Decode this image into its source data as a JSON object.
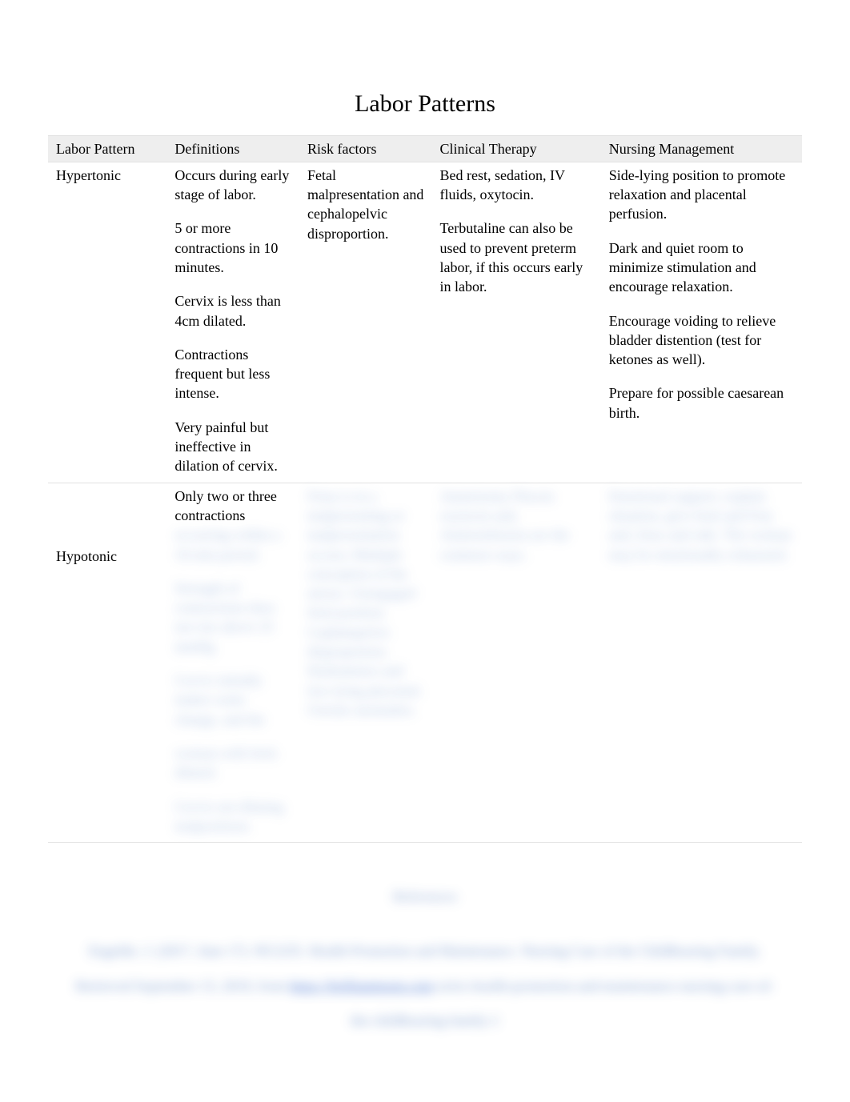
{
  "title": "Labor Patterns",
  "headers": {
    "c0": "Labor Pattern",
    "c1": "Definitions",
    "c2": "Risk factors",
    "c3": "Clinical Therapy",
    "c4": "Nursing Management"
  },
  "rows": {
    "hypertonic": {
      "pattern": "Hypertonic",
      "definitions": {
        "p1": "Occurs during early stage of labor.",
        "p2": "5 or more contractions in 10 minutes.",
        "p3": "Cervix is less than 4cm dilated.",
        "p4": "Contractions frequent but less intense.",
        "p5": "Very painful but ineffective in dilation of cervix."
      },
      "risk": {
        "p1": "Fetal malpresentation and cephalopelvic disproportion."
      },
      "therapy": {
        "p1": "Bed rest, sedation, IV fluids, oxytocin.",
        "p2": "Terbutaline can also be used to prevent preterm labor, if this occurs early in labor."
      },
      "nursing": {
        "p1": "Side-lying position to promote relaxation and placental perfusion.",
        "p2": "Dark and quiet room to minimize stimulation and encourage relaxation.",
        "p3": "Encourage voiding to relieve bladder distention (test for ketones as well).",
        "p4": "Prepare for possible caesarean birth."
      }
    },
    "hypotonic": {
      "pattern": "Hypotonic",
      "definitions": {
        "p1": "Only two or three contractions",
        "p2": "occurring within a 10-min period.",
        "p3": "Strength of contractions does not rise above 25 mmHg",
        "p4": "Cervix initially makes some change, and the",
        "p5": "woman with feels dilated.",
        "p6": "Cervix not dilating malpositions."
      },
      "risk": {
        "p1": "Fetus is in a malpresenting or malpresentation occurs; Multiple conception of the uterus. Unengaged fetal position. Cephalopelvic disproportion. Hydramnios and low-lying placental. Uterine anomalies."
      },
      "therapy": {
        "p1": "Amniotomy Pitocin oxytocin and, Amnioinfusion are the common ways."
      },
      "nursing": {
        "p1": "Emotional support, explain situation, give fetal and Fety and, fetus and side. The woman may be emotionally exhausted."
      }
    }
  },
  "references": {
    "heading": "References",
    "body_pre": "Engeldo. J. (2017, June 17). NCLEX. Health Promotion and Maintenance. Nursing Care of the Childbearing Family. Retrieved September 15, 2019, from ",
    "link": "https://brilliantmom.com",
    "body_post": " nclex-health-promotion-and-maintenance-nursing-care-of-the-childbearing-family-1"
  }
}
